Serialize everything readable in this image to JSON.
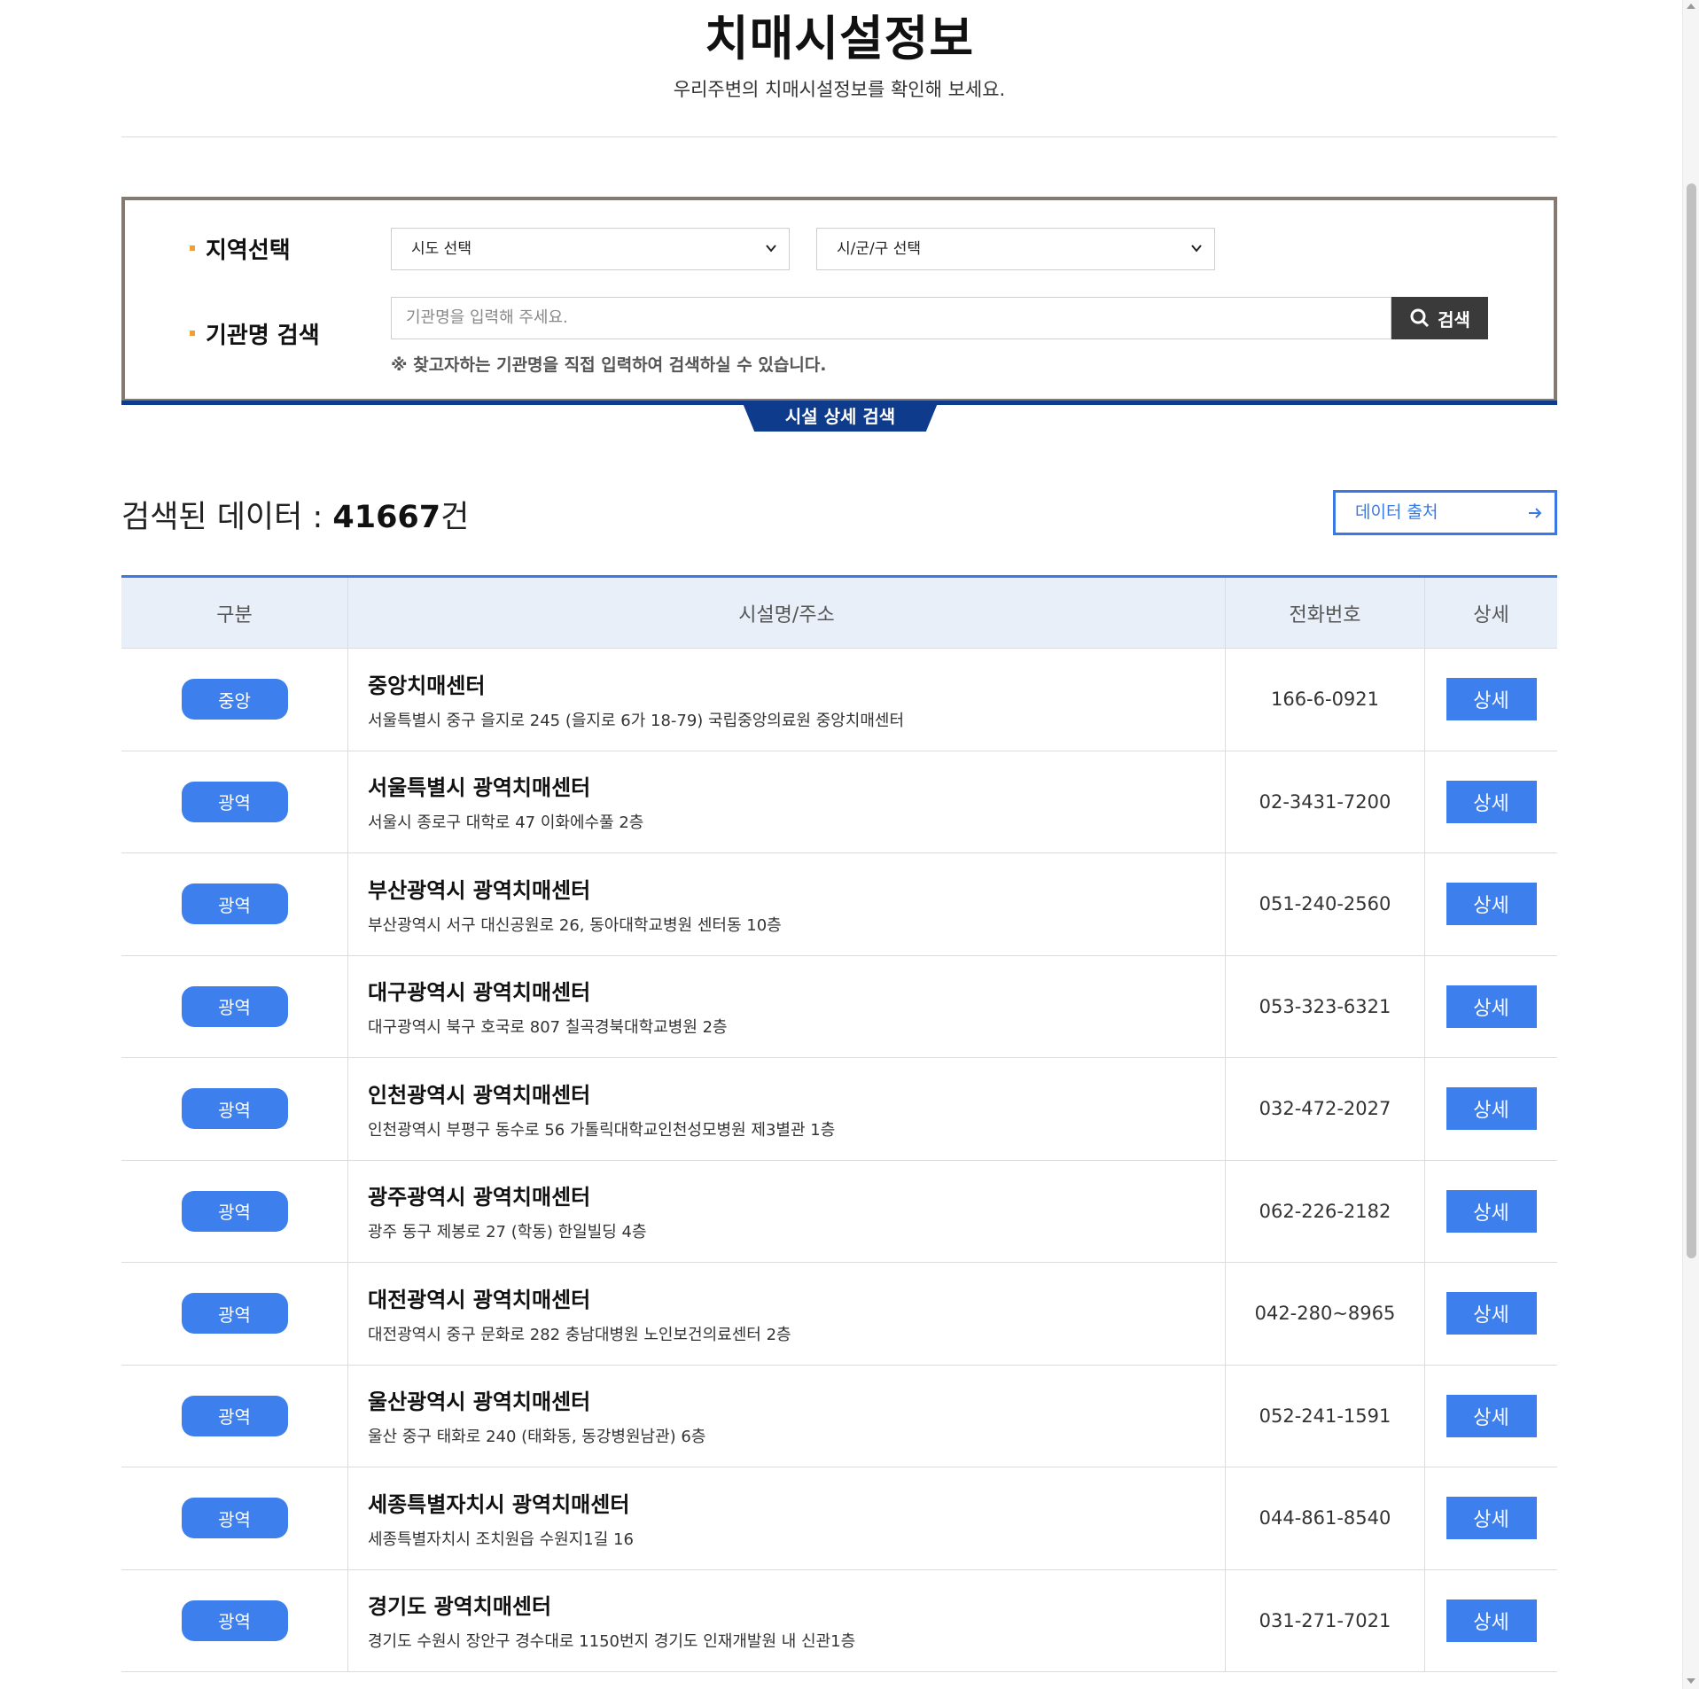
{
  "header": {
    "title": "치매시설정보",
    "subtitle": "우리주변의 치매시설정보를 확인해 보세요."
  },
  "search": {
    "region_label": "지역선택",
    "sido_select": "시도 선택",
    "sigungu_select": "시/군/구 선택",
    "name_label": "기관명 검색",
    "name_placeholder": "기관명을 입력해 주세요.",
    "search_button": "검색",
    "note": "※ 찾고자하는 기관명을 직접 입력하여 검색하실 수 있습니다.",
    "detail_tab": "시설 상세 검색"
  },
  "results": {
    "count_prefix": "검색된 데이터 : ",
    "count": "41667",
    "count_suffix": "건",
    "source_button": "데이터 출처"
  },
  "table": {
    "headers": [
      "구분",
      "시설명/주소",
      "전화번호",
      "상세"
    ],
    "detail_label": "상세",
    "rows": [
      {
        "type": "중앙",
        "name": "중앙치매센터",
        "address": "서울특별시 중구 을지로 245 (을지로 6가 18-79) 국립중앙의료원 중앙치매센터",
        "phone": "166-6-0921"
      },
      {
        "type": "광역",
        "name": "서울특별시 광역치매센터",
        "address": "서울시 종로구 대학로 47 이화에수풀 2층",
        "phone": "02-3431-7200"
      },
      {
        "type": "광역",
        "name": "부산광역시 광역치매센터",
        "address": "부산광역시 서구 대신공원로 26, 동아대학교병원 센터동 10층",
        "phone": "051-240-2560"
      },
      {
        "type": "광역",
        "name": "대구광역시 광역치매센터",
        "address": "대구광역시 북구 호국로 807 칠곡경북대학교병원 2층",
        "phone": "053-323-6321"
      },
      {
        "type": "광역",
        "name": "인천광역시 광역치매센터",
        "address": "인천광역시 부평구 동수로 56 가톨릭대학교인천성모병원 제3별관 1층",
        "phone": "032-472-2027"
      },
      {
        "type": "광역",
        "name": "광주광역시 광역치매센터",
        "address": "광주 동구 제봉로 27 (학동) 한일빌딩 4층",
        "phone": "062-226-2182"
      },
      {
        "type": "광역",
        "name": "대전광역시 광역치매센터",
        "address": "대전광역시 중구 문화로 282 충남대병원 노인보건의료센터 2층",
        "phone": "042-280~8965"
      },
      {
        "type": "광역",
        "name": "울산광역시 광역치매센터",
        "address": "울산 중구 태화로 240 (태화동, 동강병원남관) 6층",
        "phone": "052-241-1591"
      },
      {
        "type": "광역",
        "name": "세종특별자치시 광역치매센터",
        "address": "세종특별자치시 조치원읍 수원지1길 16",
        "phone": "044-861-8540"
      },
      {
        "type": "광역",
        "name": "경기도 광역치매센터",
        "address": "경기도 수원시 장안구 경수대로 1150번지 경기도 인재개발원 내 신관1층",
        "phone": "031-271-7021"
      }
    ]
  },
  "colors": {
    "accent_blue": "#3e7fee",
    "navy": "#0e3b8c",
    "box_border": "#857a70",
    "bullet_orange": "#f0a030"
  },
  "icons": {
    "search": "search-icon",
    "chevron": "chevron-down-icon",
    "arrow": "arrow-right-icon"
  }
}
